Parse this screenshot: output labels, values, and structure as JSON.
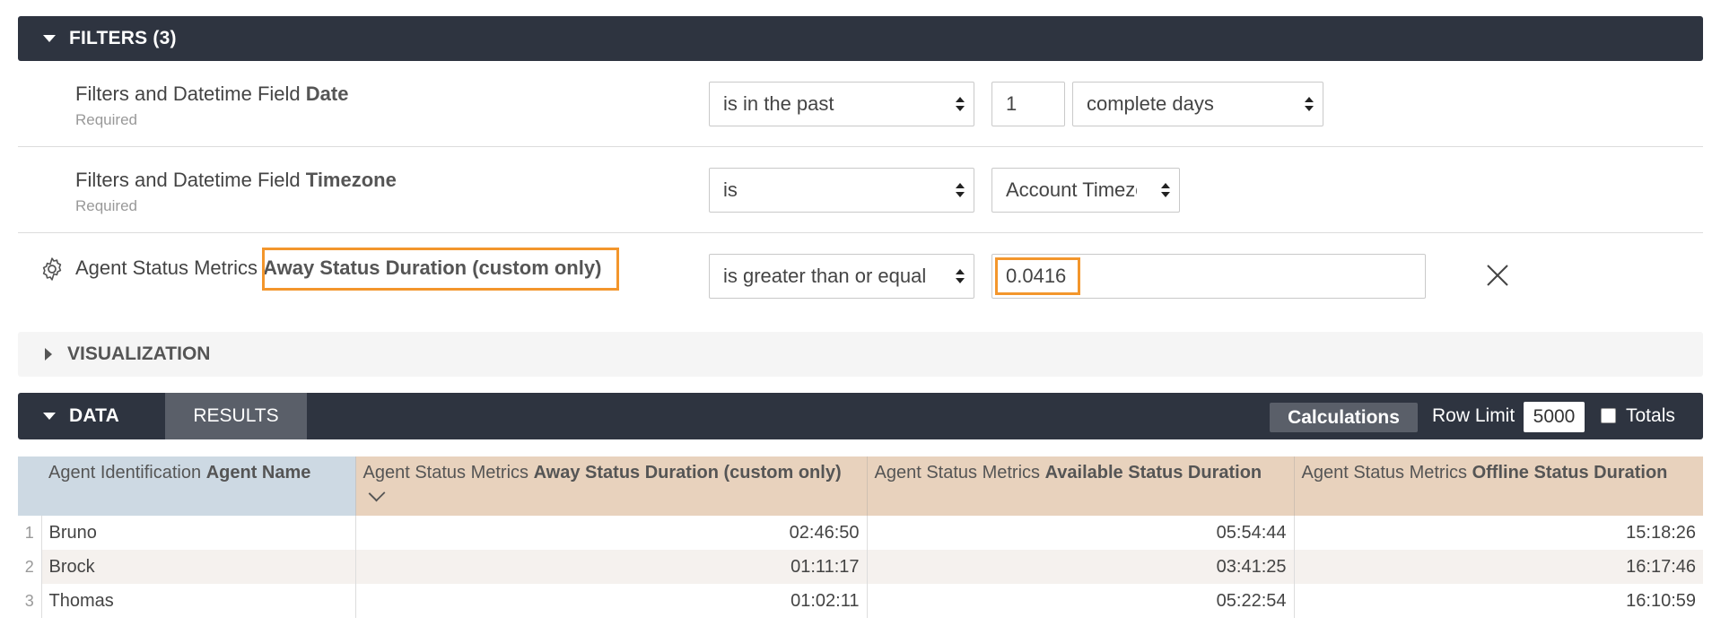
{
  "filters_section": {
    "title": "FILTERS (3)"
  },
  "filters": [
    {
      "label_prefix": "Filters and Datetime Field",
      "label_field": "Date",
      "required": "Required",
      "operator": "is in the past",
      "value": "1",
      "unit": "complete days"
    },
    {
      "label_prefix": "Filters and Datetime Field",
      "label_field": "Timezone",
      "required": "Required",
      "operator": "is",
      "value": "Account Timezone"
    },
    {
      "label_prefix": "Agent Status Metrics",
      "label_field": "Away Status Duration (custom only)",
      "operator": "is greater than or equal",
      "value": "0.0416"
    }
  ],
  "visualization_section": {
    "title": "VISUALIZATION"
  },
  "data_section": {
    "title": "DATA",
    "results_tab": "RESULTS",
    "calculations_label": "Calculations",
    "row_limit_label": "Row Limit",
    "row_limit_value": "5000",
    "totals_label": "Totals",
    "totals_checked": false
  },
  "table": {
    "columns": [
      {
        "prefix": "Agent Identification",
        "field": "Agent Name"
      },
      {
        "prefix": "Agent Status Metrics",
        "field": "Away Status Duration (custom only)",
        "sorted": "descending"
      },
      {
        "prefix": "Agent Status Metrics",
        "field": "Available Status Duration"
      },
      {
        "prefix": "Agent Status Metrics",
        "field": "Offline Status Duration"
      }
    ],
    "rows": [
      {
        "index": "1",
        "cells": [
          "Bruno",
          "02:46:50",
          "05:54:44",
          "15:18:26"
        ]
      },
      {
        "index": "2",
        "cells": [
          "Brock",
          "01:11:17",
          "03:41:25",
          "16:17:46"
        ]
      },
      {
        "index": "3",
        "cells": [
          "Thomas",
          "01:02:11",
          "05:22:54",
          "16:10:59"
        ]
      }
    ]
  },
  "colors": {
    "header_bar": "#2e3440",
    "highlight": "#f3962c",
    "dimension_header": "#cdd9e3",
    "measure_header": "#e8d2bd"
  }
}
